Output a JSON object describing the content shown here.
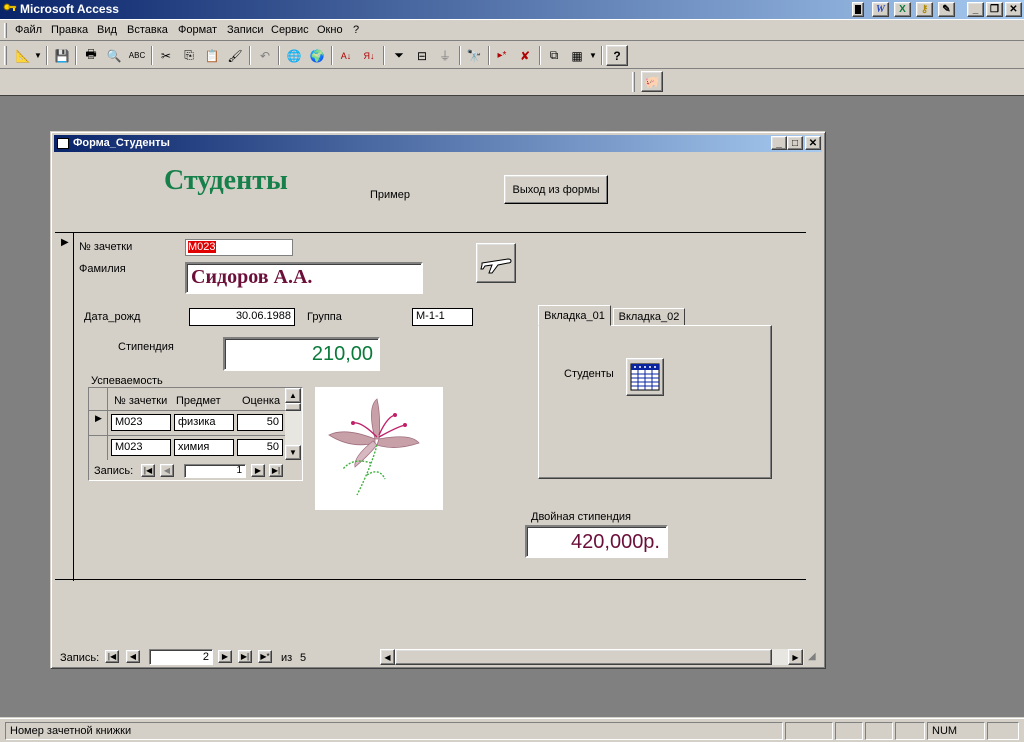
{
  "app": {
    "title": "Microsoft Access",
    "title_right_icons": [
      "word-icon",
      "excel-icon",
      "key-icon",
      "notepad-icon"
    ]
  },
  "menu": {
    "items": [
      "Файл",
      "Правка",
      "Вид",
      "Вставка",
      "Формат",
      "Записи",
      "Сервис",
      "Окно",
      "?"
    ]
  },
  "form": {
    "window_title": "Форма_Студенты",
    "heading": "Студенты",
    "example_label": "Пример",
    "exit_button": "Выход из формы",
    "fields": {
      "zachetka_label": "№ зачетки",
      "zachetka_value": "М023",
      "familiya_label": "Фамилия",
      "familiya_value": "Сидоров А.А.",
      "dob_label": "Дата_рожд",
      "dob_value": "30.06.1988",
      "group_label": "Группа",
      "group_value": "М-1-1",
      "stipend_label": "Стипендия",
      "stipend_value": "210,00",
      "double_stipend_label": "Двойная стипендия",
      "double_stipend_value": "420,000р."
    },
    "subform": {
      "label": "Успеваемость",
      "columns": [
        "№ зачетки",
        "Предмет",
        "Оценка"
      ],
      "rows": [
        {
          "zachetka": "М023",
          "subject": "физика",
          "grade": "50"
        },
        {
          "zachetka": "М023",
          "subject": "химия",
          "grade": "50"
        }
      ],
      "nav_label": "Запись:",
      "nav_record": "1"
    },
    "tabs": {
      "tab1": "Вкладка_01",
      "tab2": "Вкладка_02",
      "content_label": "Студенты"
    },
    "nav": {
      "label": "Запись:",
      "record": "2",
      "of_label": "из",
      "total": "5"
    }
  },
  "statusbar": {
    "message": "Номер зачетной книжки",
    "num_indicator": "NUM"
  },
  "colors": {
    "title_gradient_start": "#0a246a",
    "title_gradient_end": "#a6caf0",
    "heading_green": "#17804a",
    "surname_maroon": "#6b0f3a",
    "stipend_green": "#0a7a3a",
    "double_stipend_maroon": "#6b0f3a",
    "selection_red": "#e00000"
  }
}
